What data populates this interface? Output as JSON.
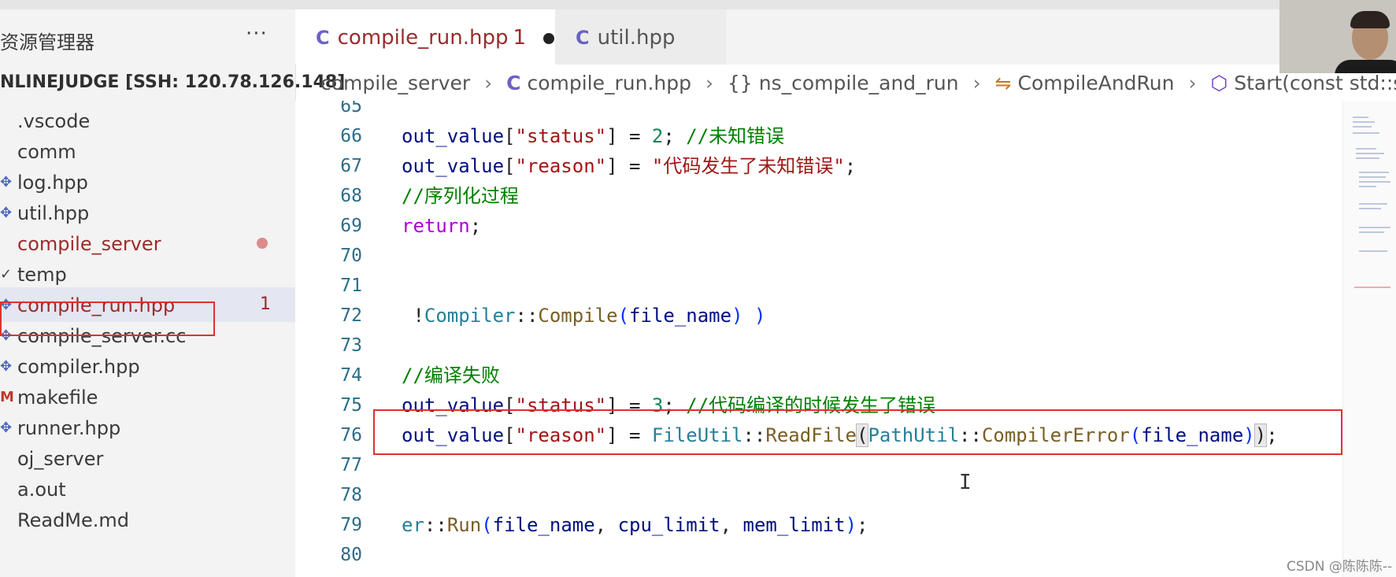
{
  "explorer": {
    "title": "资源管理器",
    "more": "···",
    "root": "NLINEJUDGE [SSH: 120.78.126.148]",
    "items": [
      {
        "label": ".vscode",
        "icon": ""
      },
      {
        "label": "comm",
        "icon": ""
      },
      {
        "label": "log.hpp",
        "icon": "cpp-header-icon"
      },
      {
        "label": "util.hpp",
        "icon": "cpp-header-icon"
      },
      {
        "label": "compile_server",
        "icon": "",
        "modified": true
      },
      {
        "label": "temp",
        "icon": "chevron-icon"
      },
      {
        "label": "compile_run.hpp",
        "icon": "cpp-header-icon",
        "errors": "1",
        "selected": true
      },
      {
        "label": "compile_server.cc",
        "icon": "cpp-header-icon"
      },
      {
        "label": "compiler.hpp",
        "icon": "cpp-header-icon"
      },
      {
        "label": "makefile",
        "icon": "makefile-icon"
      },
      {
        "label": "runner.hpp",
        "icon": "cpp-header-icon"
      },
      {
        "label": "oj_server",
        "icon": ""
      },
      {
        "label": "a.out",
        "icon": ""
      },
      {
        "label": "ReadMe.md",
        "icon": ""
      }
    ]
  },
  "tabs": [
    {
      "label": "compile_run.hpp",
      "count": "1",
      "active": true,
      "unsaved": true
    },
    {
      "label": "util.hpp",
      "active": false
    }
  ],
  "breadcrumb": {
    "folder": "compile_server",
    "file": "compile_run.hpp",
    "namespace": "ns_compile_and_run",
    "class": "CompileAndRun",
    "method": "Start(const std::string &, st"
  },
  "code_lines": [
    "65",
    "66",
    "67",
    "68",
    "69",
    "70",
    "71",
    "72",
    "73",
    "74",
    "75",
    "76",
    "77",
    "78",
    "79",
    "80"
  ],
  "watermark": "CSDN @陈陈陈--",
  "colors": {
    "accent_error": "#9c2b2b",
    "highlight_box": "#e03030"
  }
}
